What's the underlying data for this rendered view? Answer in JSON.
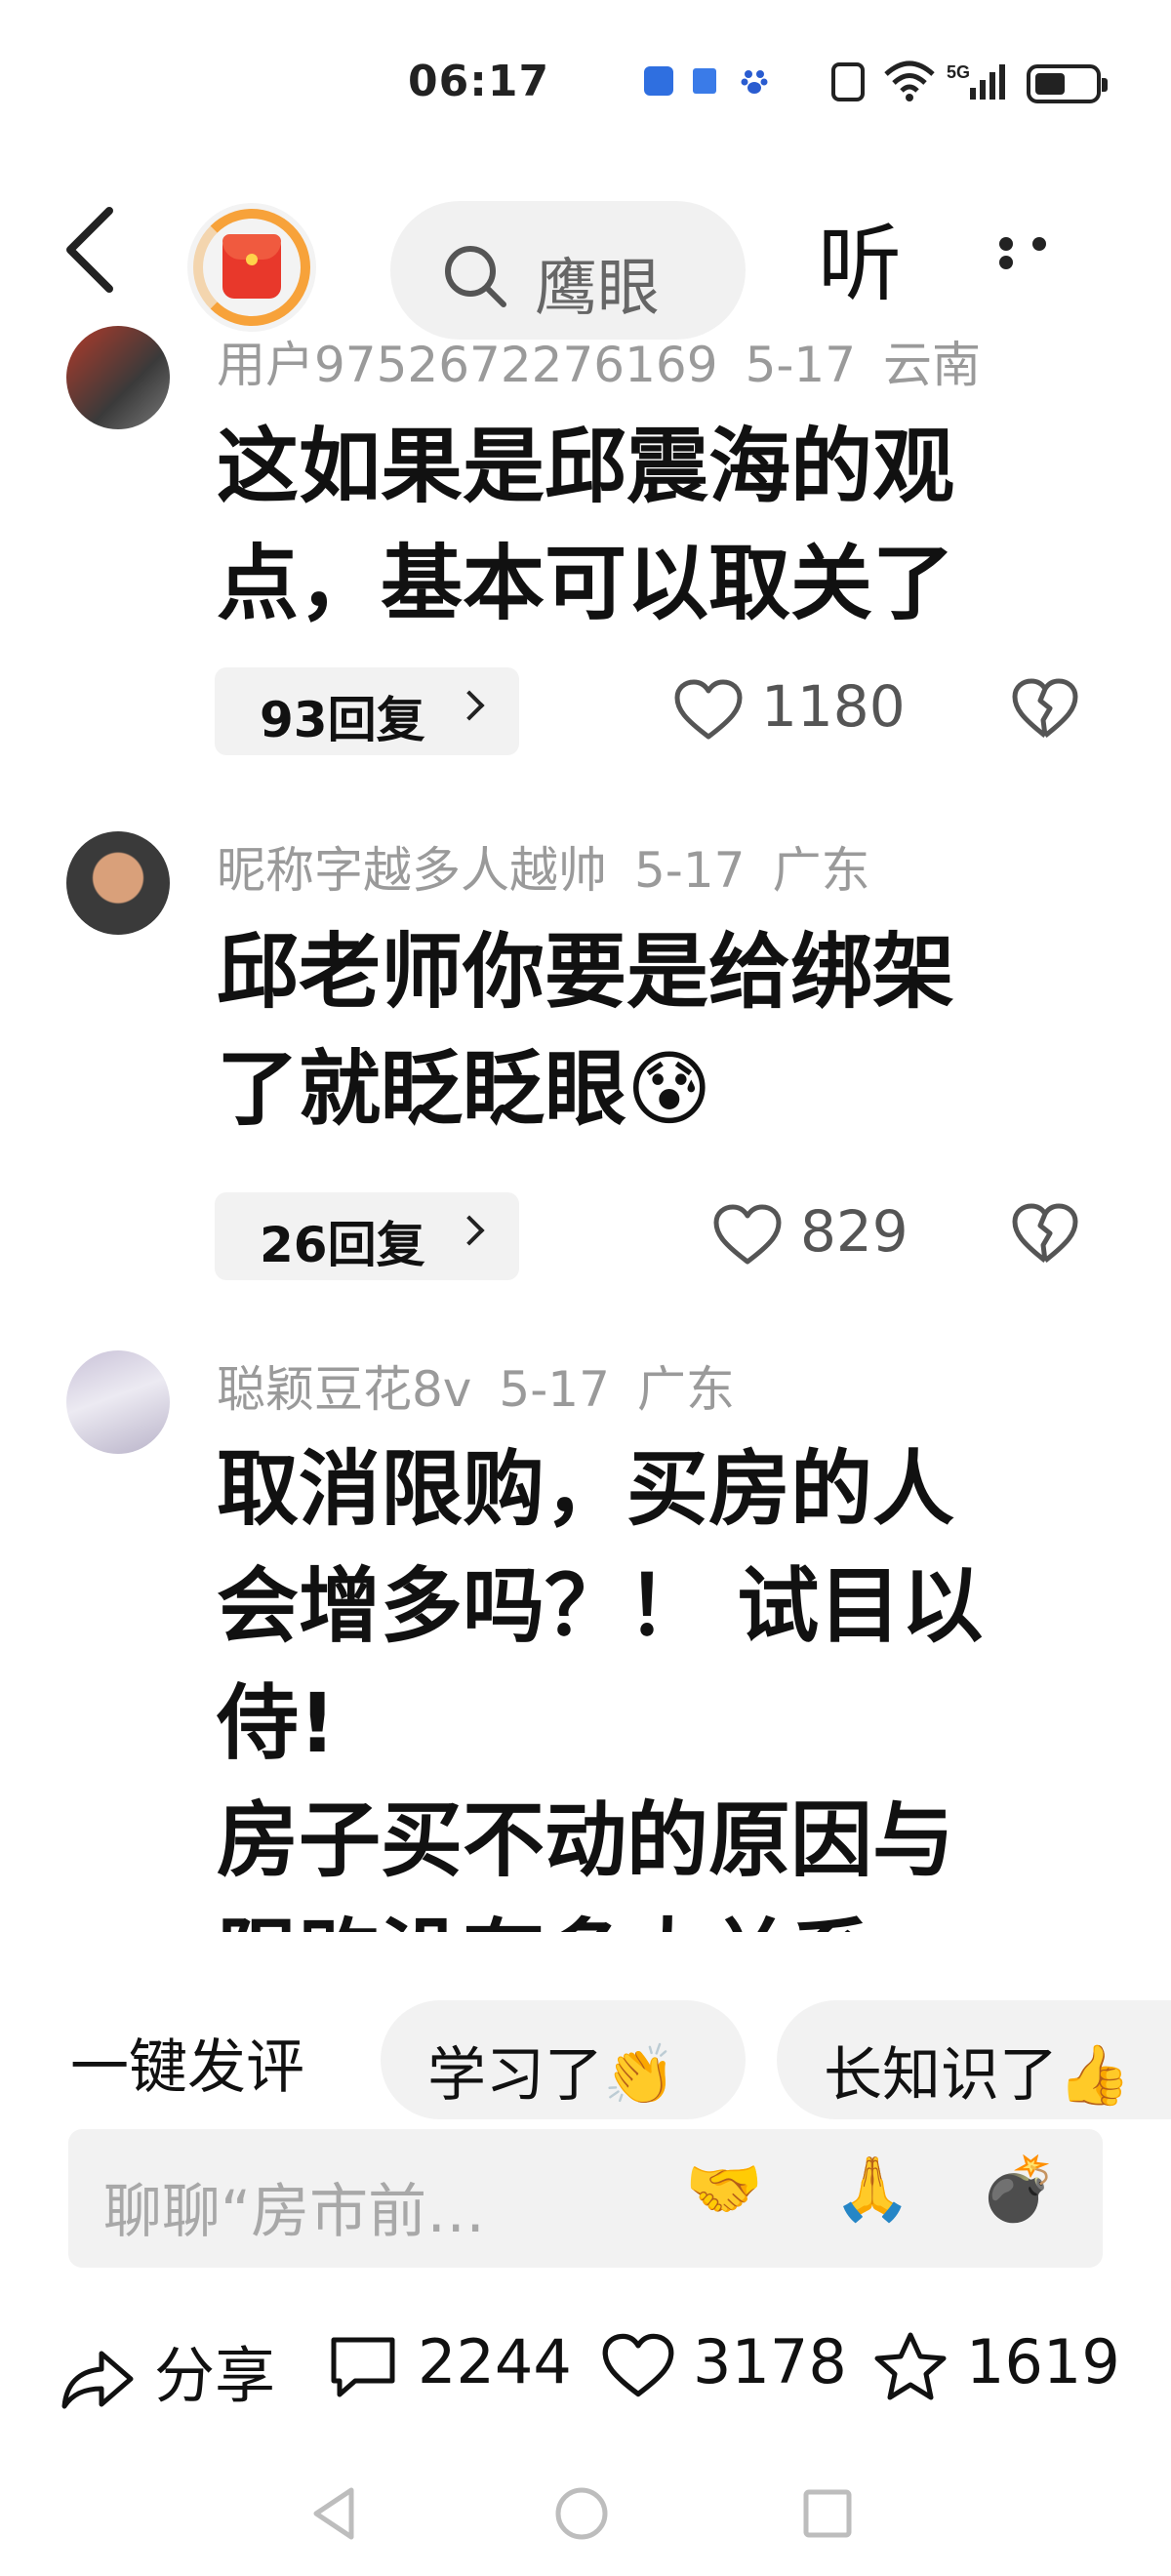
{
  "status_bar": {
    "time": "06:17",
    "right_text": "N 6 5G"
  },
  "nav": {
    "search_text": "鹰眼",
    "listen_label": "听"
  },
  "comments": [
    {
      "username": "用户9752672276169",
      "date": "5-17",
      "location": "云南",
      "text": "这如果是邱震海的观\n点，基本可以取关了",
      "replies": "93回复",
      "likes": "1180"
    },
    {
      "username": "昵称字越多人越帅",
      "date": "5-17",
      "location": "广东",
      "text": "邱老师你要是给绑架\n了就眨眨眼😰",
      "replies": "26回复",
      "likes": "829"
    },
    {
      "username": "聪颖豆花8v",
      "date": "5-17",
      "location": "广东",
      "text": "取消限购，买房的人\n会增多吗？！ 试目以\n侍!\n房子买不动的原因与\n限购没有多大关系",
      "replies": "",
      "likes": ""
    }
  ],
  "quick_reply": {
    "label": "一键发评",
    "chips": [
      "学习了👏",
      "长知识了👍"
    ]
  },
  "input": {
    "placeholder": "聊聊“房市前…",
    "emojis": [
      "🤝",
      "🙏",
      "💣"
    ]
  },
  "actions": {
    "share": "分享",
    "comments": "2244",
    "likes": "3178",
    "favorites": "1619"
  },
  "colors": {
    "accent_orange": "#f7a23a",
    "red_packet": "#e8382b",
    "meta_gray": "#9a9a9a"
  }
}
